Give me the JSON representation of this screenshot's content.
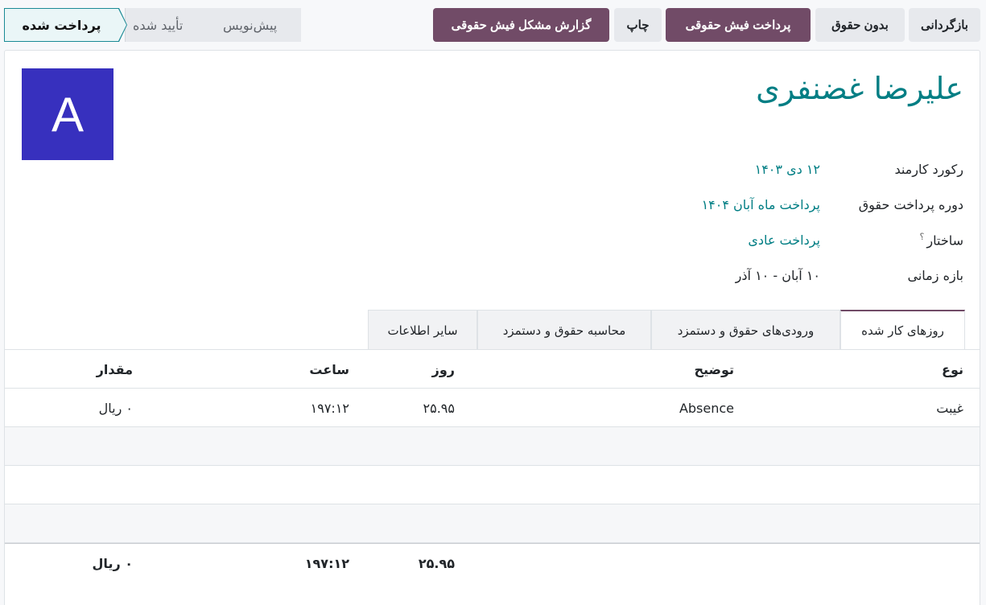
{
  "toolbar": {
    "reset_label": "بازگردانی",
    "no_salary_label": "بدون حقوق",
    "pay_label": "پرداخت فیش حقوقی",
    "print_label": "چاپ",
    "report_label": "گزارش مشکل فیش حقوقی"
  },
  "status": {
    "stages": [
      "پرداخت شده",
      "تأیید شده",
      "پیش‌نویس"
    ],
    "active": "پرداخت شده"
  },
  "avatar": {
    "initial": "A",
    "color": "#3730be"
  },
  "employee": {
    "name": "علیرضا غضنفری"
  },
  "fields": {
    "record_label": "رکورد کارمند",
    "record_value": "۱۲ دی ۱۴۰۳",
    "period_label": "دوره پرداخت حقوق",
    "period_value": "پرداخت ماه آبان ۱۴۰۴",
    "structure_label": "ساختار",
    "structure_help": "؟",
    "structure_value": "پرداخت عادی",
    "range_label": "بازه زمانی",
    "range_value": "۱۰ آبان - ۱۰ آذر"
  },
  "tabs": [
    "روزهای کار شده",
    "ورودی‌های حقوق و دستمزد",
    "محاسبه حقوق و دستمزد",
    "سایر اطلاعات"
  ],
  "table": {
    "headers": {
      "type": "نوع",
      "description": "توضیح",
      "day": "روز",
      "hour": "ساعت",
      "amount": "مقدار"
    },
    "rows": [
      {
        "type": "غیبت",
        "description": "Absence",
        "day": "۲۵.۹۵",
        "hour": "۱۹۷:۱۲",
        "amount": "۰ ریال"
      }
    ],
    "totals": {
      "day": "۲۵.۹۵",
      "hour": "۱۹۷:۱۲",
      "amount": "۰ ریال"
    }
  },
  "colors": {
    "primary": "#714b67",
    "accent": "#017e84"
  }
}
